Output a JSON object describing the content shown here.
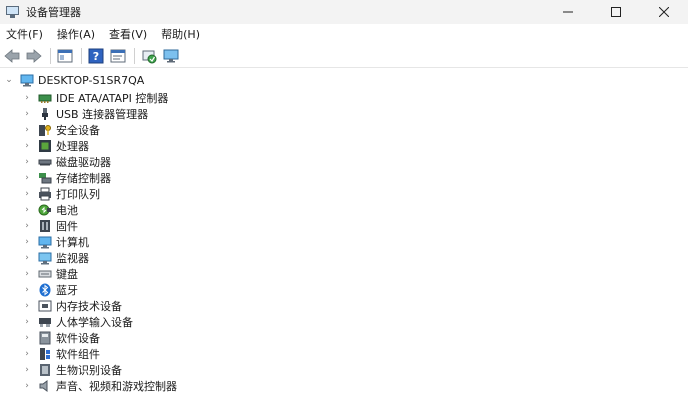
{
  "window": {
    "title": "设备管理器"
  },
  "menu": [
    "文件(F)",
    "操作(A)",
    "查看(V)",
    "帮助(H)"
  ],
  "root": {
    "label": "DESKTOP-S1SR7QA"
  },
  "categories": [
    {
      "label": "IDE ATA/ATAPI 控制器",
      "icon": "ide-controller-icon"
    },
    {
      "label": "USB 连接器管理器",
      "icon": "usb-icon"
    },
    {
      "label": "安全设备",
      "icon": "security-key-icon"
    },
    {
      "label": "处理器",
      "icon": "processor-icon"
    },
    {
      "label": "磁盘驱动器",
      "icon": "disk-drive-icon"
    },
    {
      "label": "存储控制器",
      "icon": "storage-controller-icon"
    },
    {
      "label": "打印队列",
      "icon": "printer-icon"
    },
    {
      "label": "电池",
      "icon": "battery-icon"
    },
    {
      "label": "固件",
      "icon": "firmware-icon"
    },
    {
      "label": "计算机",
      "icon": "computer-icon"
    },
    {
      "label": "监视器",
      "icon": "monitor-icon"
    },
    {
      "label": "键盘",
      "icon": "keyboard-icon"
    },
    {
      "label": "蓝牙",
      "icon": "bluetooth-icon"
    },
    {
      "label": "内存技术设备",
      "icon": "memory-device-icon"
    },
    {
      "label": "人体学输入设备",
      "icon": "hid-icon"
    },
    {
      "label": "软件设备",
      "icon": "software-device-icon"
    },
    {
      "label": "软件组件",
      "icon": "software-component-icon"
    },
    {
      "label": "生物识别设备",
      "icon": "biometric-icon"
    },
    {
      "label": "声音、视频和游戏控制器",
      "icon": "sound-icon"
    }
  ]
}
